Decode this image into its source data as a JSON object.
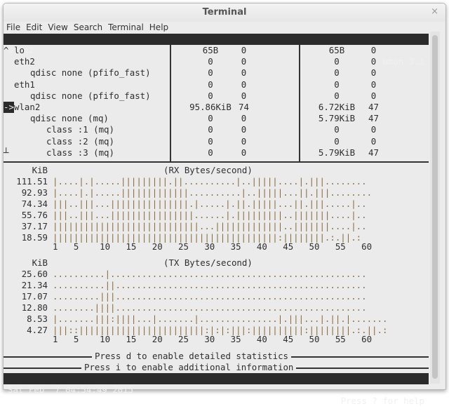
{
  "window": {
    "title": "Terminal",
    "close_icon": "×"
  },
  "menu": [
    "File",
    "Edit",
    "View",
    "Search",
    "Terminal",
    "Help"
  ],
  "header": {
    "interface": "wlan2",
    "app": "bmon 3.1"
  },
  "interfaces": [
    {
      "marker": "^",
      "name": "lo",
      "indent": 0,
      "rx_bytes": "65B",
      "rx_pkts": "0",
      "tx_bytes": "65B",
      "tx_pkts": "0"
    },
    {
      "marker": "",
      "name": "eth2",
      "indent": 0,
      "rx_bytes": "0",
      "rx_pkts": "0",
      "tx_bytes": "0",
      "tx_pkts": "0"
    },
    {
      "marker": "",
      "name": "qdisc none (pfifo_fast)",
      "indent": 1,
      "rx_bytes": "0",
      "rx_pkts": "0",
      "tx_bytes": "0",
      "tx_pkts": "0"
    },
    {
      "marker": "",
      "name": "eth1",
      "indent": 0,
      "rx_bytes": "0",
      "rx_pkts": "0",
      "tx_bytes": "0",
      "tx_pkts": "0"
    },
    {
      "marker": "",
      "name": "qdisc none (pfifo_fast)",
      "indent": 1,
      "rx_bytes": "0",
      "rx_pkts": "0",
      "tx_bytes": "0",
      "tx_pkts": "0"
    },
    {
      "marker": "->",
      "name": "wlan2",
      "indent": 0,
      "selected": true,
      "rx_bytes": "95.86KiB",
      "rx_pkts": "74",
      "tx_bytes": "6.72KiB",
      "tx_pkts": "47"
    },
    {
      "marker": "",
      "name": "qdisc none (mq)",
      "indent": 1,
      "rx_bytes": "0",
      "rx_pkts": "0",
      "tx_bytes": "5.79KiB",
      "tx_pkts": "47"
    },
    {
      "marker": "",
      "name": "class :1 (mq)",
      "indent": 2,
      "rx_bytes": "0",
      "rx_pkts": "0",
      "tx_bytes": "0",
      "tx_pkts": "0"
    },
    {
      "marker": "",
      "name": "class :2 (mq)",
      "indent": 2,
      "rx_bytes": "0",
      "rx_pkts": "0",
      "tx_bytes": "0",
      "tx_pkts": "0"
    },
    {
      "marker": "┴",
      "name": "class :3 (mq)",
      "indent": 2,
      "rx_bytes": "0",
      "rx_pkts": "0",
      "tx_bytes": "5.79KiB",
      "tx_pkts": "47"
    }
  ],
  "graphs": [
    {
      "unit": "KiB",
      "title": "(RX Bytes/second)",
      "levels": [
        "111.51",
        "92.93",
        "74.34",
        "55.76",
        "37.17",
        "18.59"
      ],
      "rows": [
        "|....|.|.....|||||||||.||..........|..|||||....|.|||........",
        "|....|.|.....|||||||||||||..........|..|||||...||.|||........",
        "|||..|||...|||||||||||||||.|.....|.||.|||||...||.|||.....|..",
        "|||..|||...||||||||||||||||......|.|||||||||..|||||||....|..",
        "||||||||||||||||||||||||||||...|||||||||||||..|||||||....|..",
        "|||||||||||||||||||||||||||||||||||||||||||:||||||||.:.||.:"
      ],
      "x_ticks": "1   5    10   15   20   25   30   35   40   45   50   55   60"
    },
    {
      "unit": "KiB",
      "title": "(TX Bytes/second)",
      "levels": [
        "25.60",
        "21.34",
        "17.07",
        "12.80",
        "8.53",
        "4.27"
      ],
      "rows": [
        "..........|.................................................",
        "..........||................................................",
        ".........|||................................................",
        "........||||................................................",
        "|.......|||:||||...|.......|...............|.|||...|.||.|.......",
        "|||::||||||||||||||||||||||||:|:|:|||:||||||||||:||||||||.:.||.:"
      ],
      "x_ticks": "1   5    10   15   20   25   30   35   40   45   50   55   60"
    }
  ],
  "info": [
    "Press d to enable detailed statistics",
    "Press i to enable additional information"
  ],
  "status": {
    "datetime": "Sat Feb  7 04:54:49 2015",
    "help": "Press ? for help"
  }
}
